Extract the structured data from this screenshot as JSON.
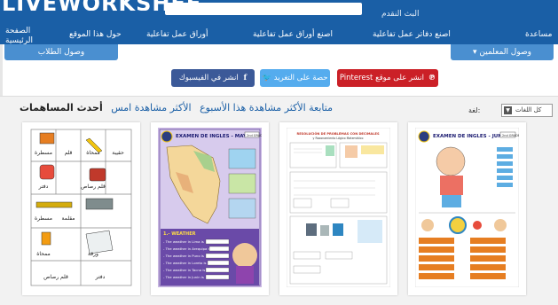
{
  "header": {
    "logo_text": "LIVEWORKSHEETS",
    "prog_text": "البث النقدم"
  },
  "nav": {
    "items": [
      {
        "label": "الصفحة الرئيسية"
      },
      {
        "label": "حول هذا الموقع"
      },
      {
        "label": "أوراق عمل تفاعلية"
      },
      {
        "label": "اصنع أوراق عمل تفاعلية"
      },
      {
        "label": "اصنع دفاتر عمل تفاعلية"
      },
      {
        "label": "مساعدة"
      }
    ],
    "students_access": "وصول الطلاب",
    "teachers_access": "وصول المعلمين"
  },
  "share": {
    "facebook": "انشر في الفيسبوك",
    "twitter": "حصة على التغريد",
    "pinterest": "Pinterest انشر على موقع"
  },
  "tabs": {
    "latest": "أحدث المساهمات",
    "most_viewed_yesterday": "الأكثر مشاهدة امس",
    "most_viewed_week": "الأكثر مشاهدة هذا الأسبوع",
    "follow": "متابعة"
  },
  "language": {
    "label": "لغة:",
    "selected": "كل اللغات"
  },
  "worksheets": [
    {
      "title": "",
      "items": [
        "مسطرة",
        "قلم",
        "ممحاة",
        "حقيبة",
        "دفتر",
        "قلم رصاص",
        "مسطرة",
        "مقلمة",
        "ممحاة",
        "ورقة",
        "دفتر",
        "قلم رصاص"
      ]
    },
    {
      "title": "EXAMEN DE INGLES - MAYO",
      "grade": "2nd GRADE",
      "section": "1.- WEATHER",
      "lines": [
        "- The weather in Lima is",
        "- The weather in Arequipa is",
        "- The weather in Puno is",
        "- The weather in Loreto is",
        "- The weather in Tacna is",
        "- The weather in Junin is"
      ]
    },
    {
      "title": "RESOLUCIÓN DE PROBLEMAS CON DECIMALES",
      "subtitle": "y Razonamiento Lógico Matemático"
    },
    {
      "title": "EXAMEN DE INGLES - JUNIO",
      "grade": "2nd GRADE"
    }
  ],
  "colors": {
    "brand": "#1a5fa6",
    "accent": "#4a8fd0",
    "facebook": "#3b5998",
    "twitter": "#55acee",
    "pinterest": "#cb2027"
  }
}
